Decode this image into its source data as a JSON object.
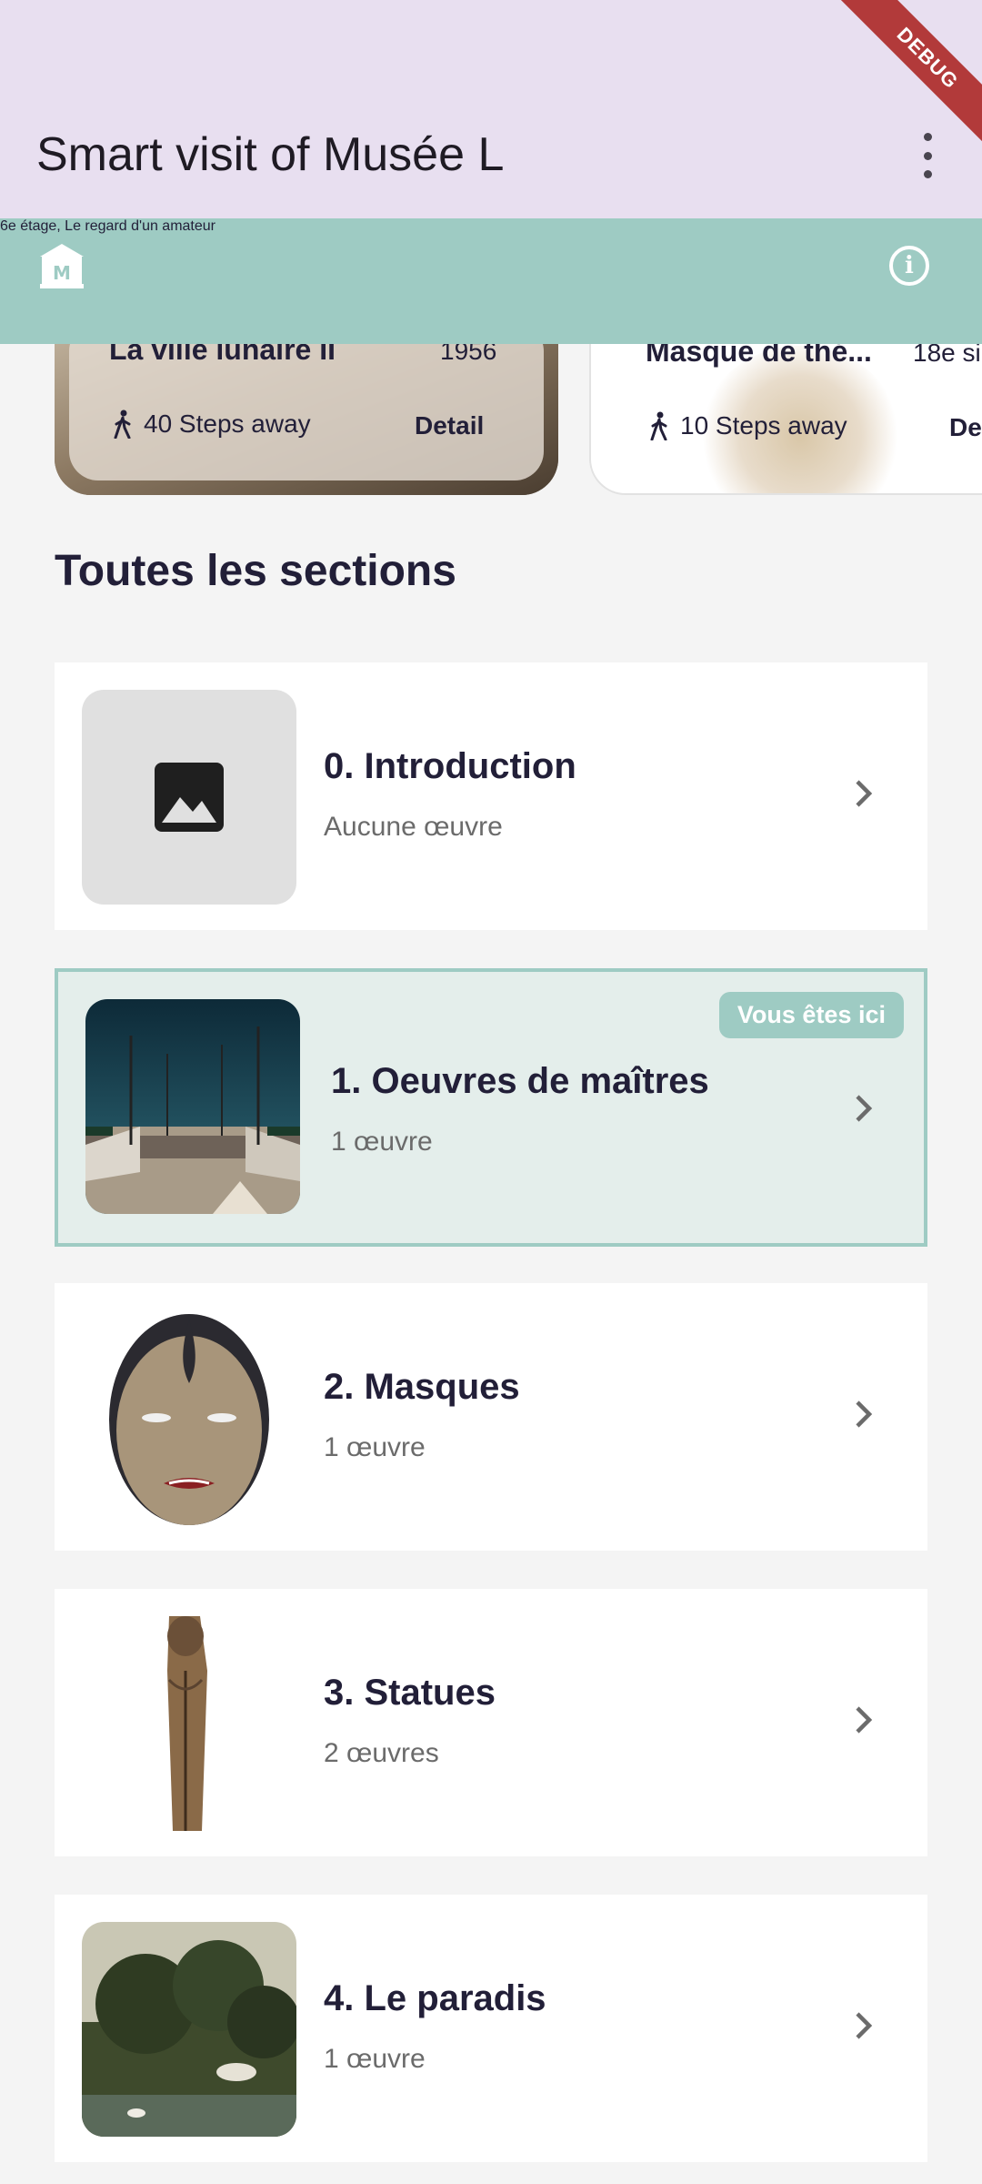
{
  "app": {
    "title": "Smart visit of Musée L",
    "debug_label": "DEBUG"
  },
  "banner": {
    "location": "6e étage, Le regard d'un amateur"
  },
  "carousel": [
    {
      "title": "La ville lunaire II",
      "year": "1956",
      "steps": "40 Steps away",
      "detail": "Detail"
    },
    {
      "title": "Masque de thé...",
      "year": "18e si",
      "steps": "10 Steps away",
      "detail": "De"
    }
  ],
  "sections_heading": "Toutes les sections",
  "sections": [
    {
      "title": "0. Introduction",
      "subtitle": "Aucune œuvre"
    },
    {
      "title": "1. Oeuvres de maîtres",
      "subtitle": "1 œuvre",
      "badge": "Vous êtes ici"
    },
    {
      "title": "2. Masques",
      "subtitle": "1 œuvre"
    },
    {
      "title": "3. Statues",
      "subtitle": "2 œuvres"
    },
    {
      "title": "4. Le paradis",
      "subtitle": "1 œuvre"
    }
  ],
  "colors": {
    "accent": "#9ecbc3",
    "appbar": "#e8dff0",
    "text": "#221f38"
  }
}
